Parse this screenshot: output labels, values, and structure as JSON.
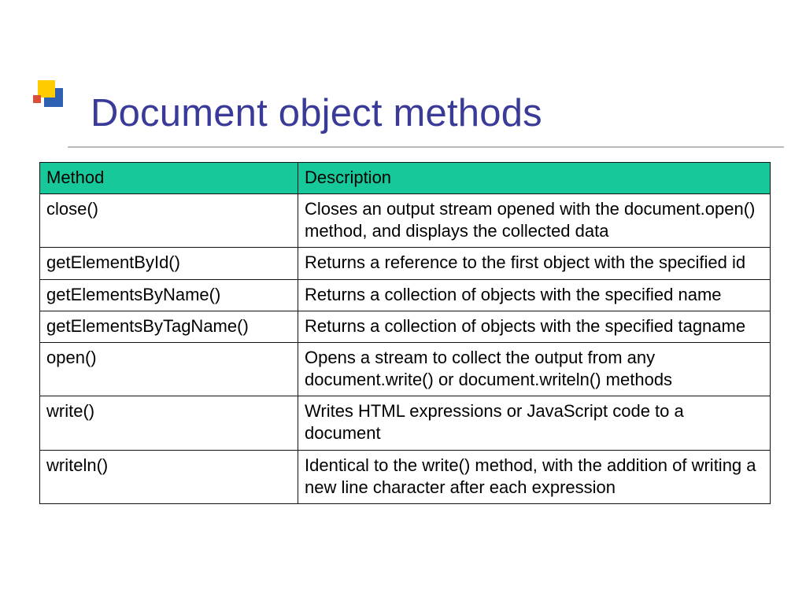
{
  "title": "Document object methods",
  "table": {
    "headers": {
      "method": "Method",
      "description": "Description"
    },
    "rows": [
      {
        "method": "close()",
        "description": "Closes an output stream opened with the document.open() method, and displays the collected data"
      },
      {
        "method": "getElementById()",
        "description": "Returns a reference to the first object with the specified id"
      },
      {
        "method": "getElementsByName()",
        "description": "Returns a collection of objects with the specified name"
      },
      {
        "method": "getElementsByTagName()",
        "description": "Returns a collection of objects with the specified tagname"
      },
      {
        "method": "open()",
        "description": "Opens a stream to collect the output from any document.write() or document.writeln() methods"
      },
      {
        "method": "write()",
        "description": "Writes HTML expressions or JavaScript code to a document"
      },
      {
        "method": "writeln()",
        "description": "Identical to the write() method, with the addition of writing a new line character after each expression"
      }
    ]
  }
}
